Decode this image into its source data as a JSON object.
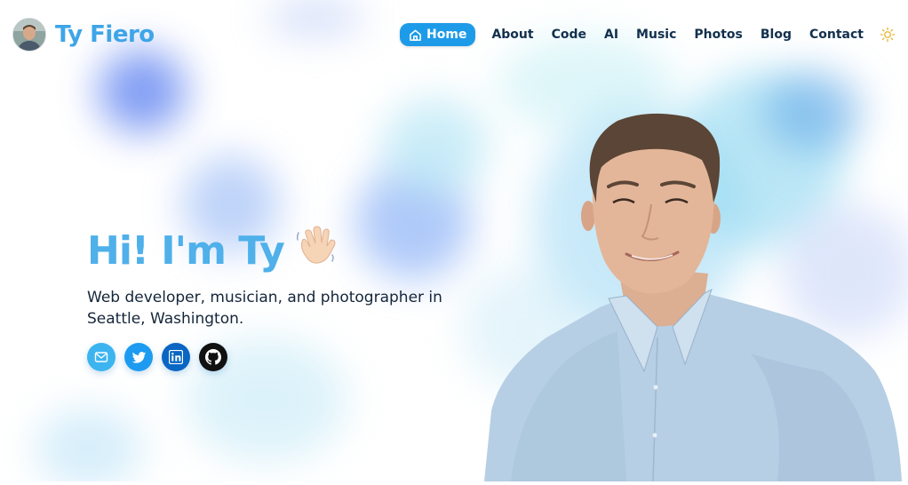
{
  "site": {
    "name": "Ty Fiero"
  },
  "nav": {
    "items": [
      {
        "label": "Home",
        "active": true
      },
      {
        "label": "About"
      },
      {
        "label": "Code"
      },
      {
        "label": "AI"
      },
      {
        "label": "Music"
      },
      {
        "label": "Photos"
      },
      {
        "label": "Blog"
      },
      {
        "label": "Contact"
      }
    ],
    "theme_toggle_icon": "sun-icon"
  },
  "hero": {
    "title": "Hi! I'm Ty",
    "title_emoji_icon": "waving-hand-icon",
    "subtitle": "Web developer, musician, and photographer in Seattle, Washington."
  },
  "socials": [
    {
      "icon": "email-icon",
      "color": "#3cb4f0"
    },
    {
      "icon": "twitter-icon",
      "color": "#1d9bf0"
    },
    {
      "icon": "linkedin-icon",
      "color": "#0a66c2"
    },
    {
      "icon": "github-icon",
      "color": "#111111"
    }
  ],
  "colors": {
    "accent": "#1e9be8",
    "title": "#4fb0ea",
    "nav_text": "#12304d"
  }
}
